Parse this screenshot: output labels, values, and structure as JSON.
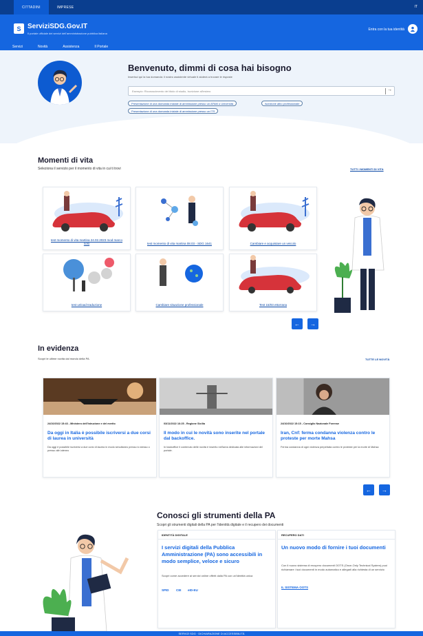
{
  "topbar": {
    "tabs": [
      "CITTADINI",
      "IMPRESE"
    ],
    "lang": "IT"
  },
  "header": {
    "title": "ServiziSDG.Gov.IT",
    "subtitle": "Il portale ufficiale dei servizi dell'amministrazione pubblica italiana",
    "login": "Entra con la tua identità",
    "logo_letter": "S"
  },
  "nav": {
    "items": [
      "Servizi",
      "Novità",
      "Assistenza",
      "Il Portale"
    ]
  },
  "hero": {
    "title": "Benvenuto, dimmi di cosa hai bisogno",
    "subtitle": "Inserisci qui la tua domanda: il nostro assistente virtuale ti aiuterà a trovare le risposte",
    "search_placeholder": "Esempio: Riconoscimento del titolo di studio, Iscrizione all'estero",
    "search_arrow": "→",
    "chips": [
      "Presentazione di una domanda iniziale di ammissione presso un AFAM o Università",
      "Iscrizione albo professionale",
      "Presentazione di una domanda iniziale di ammissione presso un ITS"
    ]
  },
  "momenti": {
    "title": "Momenti di vita",
    "subtitle": "Seleziona il servizio per il momento di vita in cui ti trovi",
    "link": "TUTTI I MOMENTI DI VITA",
    "cards": [
      {
        "label": "test momento di vita martina 24.02.2023 mod marco solo",
        "icon": "car-scene-icon"
      },
      {
        "label": "test momento di vita martina 08.03 - SDG 1641",
        "icon": "network-person-icon"
      },
      {
        "label": "Cambiare e acquistare un veicolo",
        "icon": "car-scene-icon"
      },
      {
        "label": "test unload traduzione",
        "icon": "tree-icon"
      },
      {
        "label": "Cambiare situazione professionale",
        "icon": "globe-person-icon"
      },
      {
        "label": "Test 15/03 ettorrana",
        "icon": "car-scene-icon"
      }
    ],
    "prev": "←",
    "next": "→"
  },
  "evidenza": {
    "title": "In evidenza",
    "subtitle": "Scopri le ultime novità dal mondo della PA",
    "link": "TUTTE LE NOVITÀ",
    "news": [
      {
        "meta": "24/10/2022 15:43 - Ministero dell'Istruzione e del merito",
        "title": "Da oggi in Italia è possibile iscriversi a due corsi di laurea in università",
        "text": "Da oggi è possibile iscriversi a due corsi di laurea in modo simultaneo presso lo stesso o presso altri ateneo"
      },
      {
        "meta": "03/11/2022 16:25 - Regione Sicilia",
        "title": "Il modo in cui le novità sono inserite nel portale dal backoffice.",
        "text": "In backoffice il contenuto delle novità è inserito nell'area dedicata alle informazioni del portale."
      },
      {
        "meta": "24/10/2022 15:15 - Consiglio Nazionale Forense",
        "title": "Iran, Cnf: ferma condanna violenza contro le proteste per morte Mahsa",
        "text": "Ferma condanna di ogni violenza perpetrata contro le proteste per la morte di Mahsa"
      }
    ],
    "prev": "←",
    "next": "→"
  },
  "strumenti": {
    "title": "Conosci gli strumenti della PA",
    "subtitle": "Scopri gli strumenti digitali della PA per l'identità digitale e il recupero dei documenti",
    "tools": [
      {
        "category": "IDENTITÀ DIGITALE",
        "title": "I servizi digitali della Pubblica Amministrazione (PA) sono accessibili in modo semplice, veloce e sicuro",
        "text": "Scopri come accedere ai servizi online offerti dalla PA con un'identità unica",
        "links": [
          "SPID",
          "CIE",
          "eID-EU"
        ]
      },
      {
        "category": "RECUPERO DATI",
        "title": "Un nuovo modo di fornire i tuoi documenti",
        "text": "Con il nuovo sistema di recupero documenti OOTS (Once-Only Technical System) puoi richiamare i tuoi documenti in modo automatico e allegarli alla richiesta di un servizio",
        "links": [
          "IL SISTEMA OOTS"
        ]
      }
    ]
  },
  "footer": {
    "text": "SERVIZI SDG · DICHIARAZIONE DI ACCESSIBILITÀ"
  },
  "colors": {
    "primary": "#1566e0",
    "dark": "#0a3e8f",
    "hero_bg": "#eef4fb"
  }
}
